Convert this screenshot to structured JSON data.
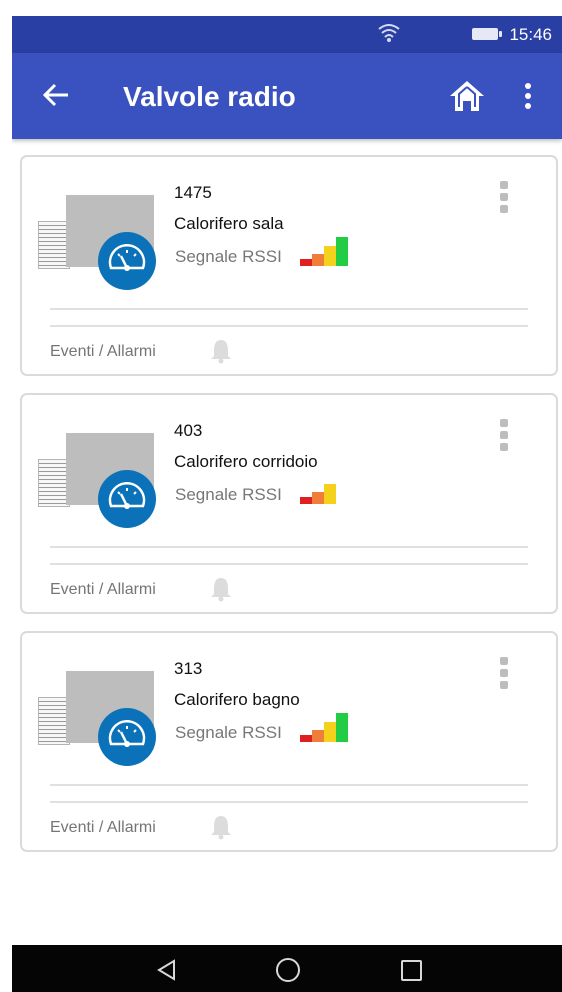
{
  "status_bar": {
    "time": "15:46",
    "icons": [
      "wifi-icon",
      "battery-icon"
    ]
  },
  "app_bar": {
    "title": "Valvole radio",
    "icons": [
      "back-arrow-icon",
      "home-icon",
      "overflow-menu-icon"
    ]
  },
  "colors": {
    "status_bar": "#2a3fa3",
    "app_bar": "#3a51c0",
    "badge": "#0b72b9",
    "signal": [
      "#e02020",
      "#f07d3a",
      "#f4d11d",
      "#22cc44"
    ]
  },
  "valves": [
    {
      "id": "1475",
      "name": "Calorifero sala",
      "rssi_label": "Segnale RSSI",
      "signal_level": 4,
      "events_label": "Eventi / Allarmi"
    },
    {
      "id": "403",
      "name": "Calorifero corridoio",
      "rssi_label": "Segnale RSSI",
      "signal_level": 3,
      "events_label": "Eventi / Allarmi"
    },
    {
      "id": "313",
      "name": "Calorifero bagno",
      "rssi_label": "Segnale RSSI",
      "signal_level": 4,
      "events_label": "Eventi / Allarmi"
    }
  ],
  "nav_bar": {
    "icons": [
      "nav-back-icon",
      "nav-home-icon",
      "nav-recents-icon"
    ]
  }
}
